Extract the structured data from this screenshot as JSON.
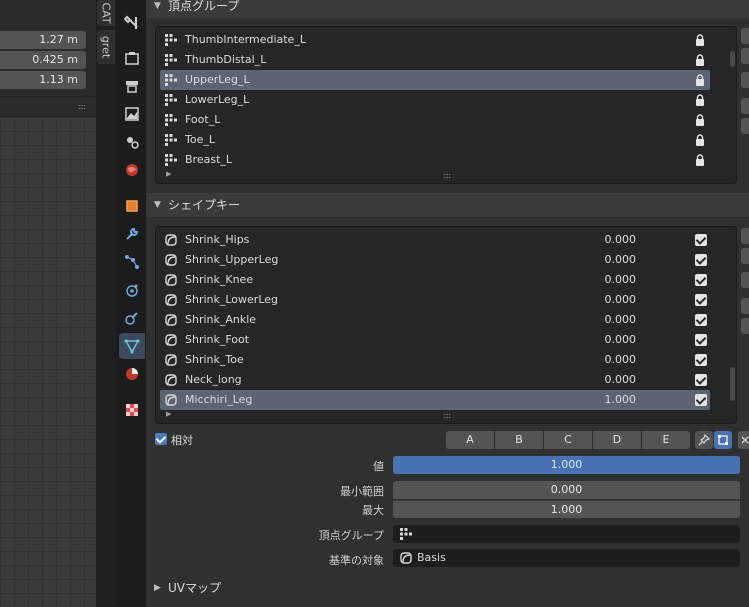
{
  "left": {
    "dimensions": [
      "1.27 m",
      "0.425 m",
      "1.13 m"
    ]
  },
  "sidebar_tabs": [
    "CAT",
    "gret"
  ],
  "vertex_groups": {
    "header": "頂点グループ",
    "items": [
      {
        "label": "ThumbIntermediate_L",
        "selected": false
      },
      {
        "label": "ThumbDistal_L",
        "selected": false
      },
      {
        "label": "UpperLeg_L",
        "selected": true
      },
      {
        "label": "LowerLeg_L",
        "selected": false
      },
      {
        "label": "Foot_L",
        "selected": false
      },
      {
        "label": "Toe_L",
        "selected": false
      },
      {
        "label": "Breast_L",
        "selected": false
      }
    ]
  },
  "shape_keys": {
    "header": "シェイプキー",
    "items": [
      {
        "label": "Shrink_Hips",
        "value": "0.000",
        "enabled": true,
        "selected": false
      },
      {
        "label": "Shrink_UpperLeg",
        "value": "0.000",
        "enabled": true,
        "selected": false
      },
      {
        "label": "Shrink_Knee",
        "value": "0.000",
        "enabled": true,
        "selected": false
      },
      {
        "label": "Shrink_LowerLeg",
        "value": "0.000",
        "enabled": true,
        "selected": false
      },
      {
        "label": "Shrink_Ankle",
        "value": "0.000",
        "enabled": true,
        "selected": false
      },
      {
        "label": "Shrink_Foot",
        "value": "0.000",
        "enabled": true,
        "selected": false
      },
      {
        "label": "Shrink_Toe",
        "value": "0.000",
        "enabled": true,
        "selected": false
      },
      {
        "label": "Neck_long",
        "value": "0.000",
        "enabled": true,
        "selected": false
      },
      {
        "label": "Micchiri_Leg",
        "value": "1.000",
        "enabled": true,
        "selected": true
      }
    ]
  },
  "relative": {
    "label": "相対",
    "checked": true,
    "tabs": [
      "A",
      "B",
      "C",
      "D",
      "E"
    ]
  },
  "properties": {
    "value_label": "値",
    "value": "1.000",
    "value_fraction": 1.0,
    "min_label": "最小範囲",
    "min_value": "0.000",
    "max_label": "最大",
    "max_value": "1.000",
    "vgroup_label": "頂点グループ",
    "vgroup_value": "",
    "relative_to_label": "基準の対象",
    "relative_to_value": "Basis"
  },
  "uv_section": {
    "header": "UVマップ"
  },
  "colors": {
    "accent": "#4772b3",
    "selected_row": "#5a6473",
    "panel_bg": "#303030"
  }
}
